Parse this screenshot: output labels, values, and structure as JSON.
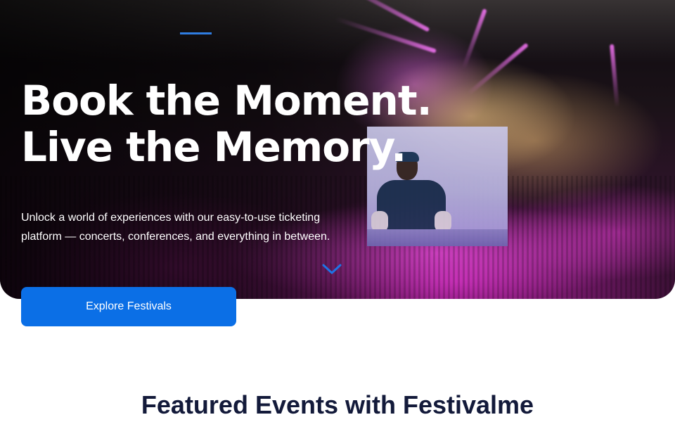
{
  "hero": {
    "title_line1": "Book the Moment.",
    "title_line2": "Live the Memory.",
    "subtitle": "Unlock a world of experiences with our easy-to-use ticketing platform — concerts, conferences, and everything in between."
  },
  "cta": {
    "label": "Explore Festivals"
  },
  "featured": {
    "heading": "Featured Events with Festivalme"
  },
  "icons": {
    "scroll": "chevron-down-icon"
  },
  "colors": {
    "accent": "#0b6fe6",
    "heading": "#131a3a",
    "accent_line": "#2f7de1"
  }
}
